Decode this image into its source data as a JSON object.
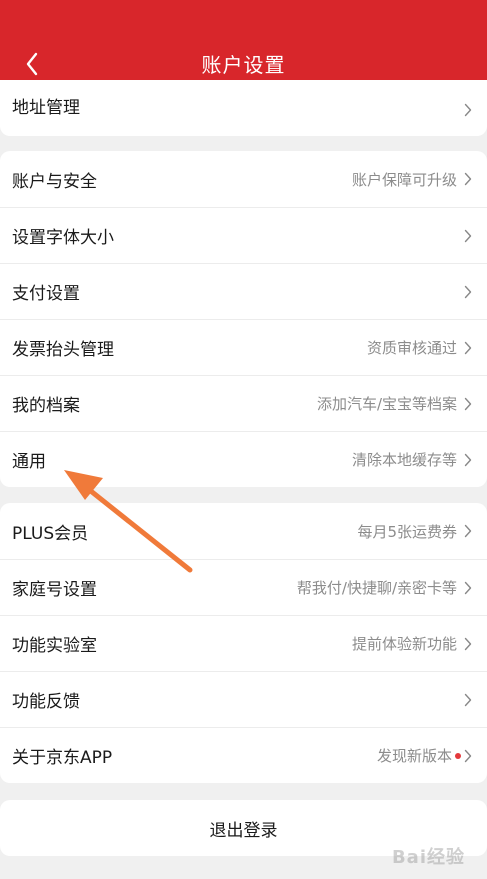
{
  "header": {
    "title": "账户设置"
  },
  "groups": [
    {
      "items": [
        {
          "label": "地址管理",
          "value": ""
        }
      ]
    },
    {
      "items": [
        {
          "label": "账户与安全",
          "value": "账户保障可升级"
        },
        {
          "label": "设置字体大小",
          "value": ""
        },
        {
          "label": "支付设置",
          "value": ""
        },
        {
          "label": "发票抬头管理",
          "value": "资质审核通过"
        },
        {
          "label": "我的档案",
          "value": "添加汽车/宝宝等档案"
        },
        {
          "label": "通用",
          "value": "清除本地缓存等"
        }
      ]
    },
    {
      "items": [
        {
          "label": "PLUS会员",
          "value": "每月5张运费券"
        },
        {
          "label": "家庭号设置",
          "value": "帮我付/快捷聊/亲密卡等"
        },
        {
          "label": "功能实验室",
          "value": "提前体验新功能"
        },
        {
          "label": "功能反馈",
          "value": ""
        },
        {
          "label": "关于京东APP",
          "value": "发现新版本"
        }
      ]
    }
  ],
  "logout": {
    "label": "退出登录"
  },
  "watermark": {
    "text": "Bai经验"
  },
  "colors": {
    "header_red": "#d8262b",
    "update_dot": "#e4393c",
    "annotation_arrow": "#f07a3a"
  }
}
